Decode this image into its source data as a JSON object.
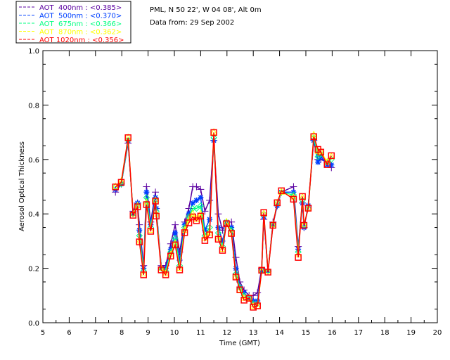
{
  "header": {
    "station": "PML, N 50 22', W 04 08', Alt 0m",
    "date": "Data from: 29 Sep 2002"
  },
  "chart_data": {
    "type": "line",
    "title": "",
    "xlabel": "Time (GMT)",
    "ylabel": "Aerosol Optical Thickness",
    "xlim": [
      5,
      20
    ],
    "ylim": [
      0,
      1.0
    ],
    "xticks": [
      "5",
      "6",
      "7",
      "8",
      "9",
      "10",
      "11",
      "12",
      "13",
      "14",
      "15",
      "16",
      "17",
      "18",
      "19",
      "20"
    ],
    "yticks": [
      "0.0",
      "0.2",
      "0.4",
      "0.6",
      "0.8",
      "1.0"
    ],
    "grid": false,
    "legend_position": "top-left outside",
    "x": [
      7.76,
      7.98,
      8.24,
      8.43,
      8.6,
      8.67,
      8.83,
      8.94,
      9.1,
      9.28,
      9.31,
      9.5,
      9.67,
      9.86,
      10.03,
      10.2,
      10.39,
      10.55,
      10.7,
      10.84,
      11.0,
      11.16,
      11.34,
      11.5,
      11.67,
      11.83,
      11.98,
      12.17,
      12.34,
      12.49,
      12.65,
      12.84,
      13.0,
      13.16,
      13.32,
      13.4,
      13.56,
      13.75,
      13.91,
      14.07,
      14.53,
      14.71,
      14.87,
      14.93,
      15.09,
      15.3,
      15.46,
      15.57,
      15.81,
      15.97
    ],
    "series": [
      {
        "name": "AOT  400nm : <0.385>",
        "color": "#5a00a0",
        "marker": "plus",
        "values": [
          0.48,
          0.51,
          0.66,
          0.41,
          0.44,
          0.36,
          0.21,
          0.5,
          0.37,
          0.48,
          0.42,
          0.21,
          0.21,
          0.29,
          0.36,
          0.26,
          0.37,
          0.42,
          0.5,
          0.5,
          0.49,
          0.41,
          0.45,
          0.67,
          0.4,
          0.34,
          0.37,
          0.37,
          0.24,
          0.15,
          0.12,
          0.1,
          0.1,
          0.11,
          0.2,
          0.38,
          0.19,
          0.37,
          0.43,
          0.48,
          0.5,
          0.28,
          0.44,
          0.35,
          0.43,
          0.67,
          0.6,
          0.6,
          0.59,
          0.57
        ]
      },
      {
        "name": "AOT  500nm : <0.370>",
        "color": "#0040ff",
        "marker": "asterisk",
        "values": [
          0.49,
          0.51,
          0.67,
          0.4,
          0.44,
          0.34,
          0.2,
          0.48,
          0.36,
          0.46,
          0.42,
          0.2,
          0.2,
          0.27,
          0.33,
          0.23,
          0.36,
          0.4,
          0.44,
          0.45,
          0.46,
          0.34,
          0.38,
          0.67,
          0.35,
          0.3,
          0.37,
          0.35,
          0.2,
          0.13,
          0.11,
          0.09,
          0.08,
          0.08,
          0.19,
          0.39,
          0.19,
          0.36,
          0.43,
          0.48,
          0.48,
          0.27,
          0.44,
          0.35,
          0.43,
          0.67,
          0.59,
          0.61,
          0.58,
          0.58
        ]
      },
      {
        "name": "AOT  675nm : <0.366>",
        "color": "#00ff80",
        "marker": "diamond",
        "values": [
          0.5,
          0.51,
          0.67,
          0.4,
          0.43,
          0.32,
          0.19,
          0.46,
          0.35,
          0.45,
          0.41,
          0.2,
          0.19,
          0.26,
          0.31,
          0.21,
          0.35,
          0.39,
          0.42,
          0.42,
          0.43,
          0.32,
          0.35,
          0.68,
          0.33,
          0.28,
          0.37,
          0.34,
          0.18,
          0.13,
          0.1,
          0.09,
          0.07,
          0.07,
          0.19,
          0.4,
          0.19,
          0.36,
          0.44,
          0.48,
          0.47,
          0.26,
          0.45,
          0.36,
          0.42,
          0.68,
          0.61,
          0.62,
          0.59,
          0.6
        ]
      },
      {
        "name": "AOT  870nm : <0.362>",
        "color": "#ffff00",
        "marker": "triangle",
        "values": [
          0.5,
          0.52,
          0.68,
          0.4,
          0.43,
          0.3,
          0.18,
          0.44,
          0.34,
          0.45,
          0.4,
          0.2,
          0.18,
          0.25,
          0.29,
          0.2,
          0.34,
          0.38,
          0.4,
          0.38,
          0.4,
          0.31,
          0.33,
          0.7,
          0.31,
          0.27,
          0.37,
          0.33,
          0.17,
          0.12,
          0.09,
          0.09,
          0.06,
          0.06,
          0.19,
          0.4,
          0.19,
          0.36,
          0.44,
          0.48,
          0.46,
          0.25,
          0.46,
          0.36,
          0.42,
          0.69,
          0.63,
          0.63,
          0.59,
          0.61
        ]
      },
      {
        "name": "AOT 1020nm : <0.356>",
        "color": "#ff0000",
        "marker": "square",
        "values": [
          0.499,
          0.516,
          0.68,
          0.395,
          0.426,
          0.297,
          0.176,
          0.434,
          0.336,
          0.447,
          0.392,
          0.194,
          0.176,
          0.245,
          0.286,
          0.194,
          0.331,
          0.367,
          0.389,
          0.375,
          0.392,
          0.302,
          0.323,
          0.699,
          0.307,
          0.266,
          0.364,
          0.328,
          0.168,
          0.121,
          0.083,
          0.09,
          0.057,
          0.062,
          0.193,
          0.405,
          0.186,
          0.358,
          0.441,
          0.485,
          0.454,
          0.24,
          0.464,
          0.358,
          0.421,
          0.684,
          0.637,
          0.627,
          0.581,
          0.614
        ]
      }
    ]
  }
}
